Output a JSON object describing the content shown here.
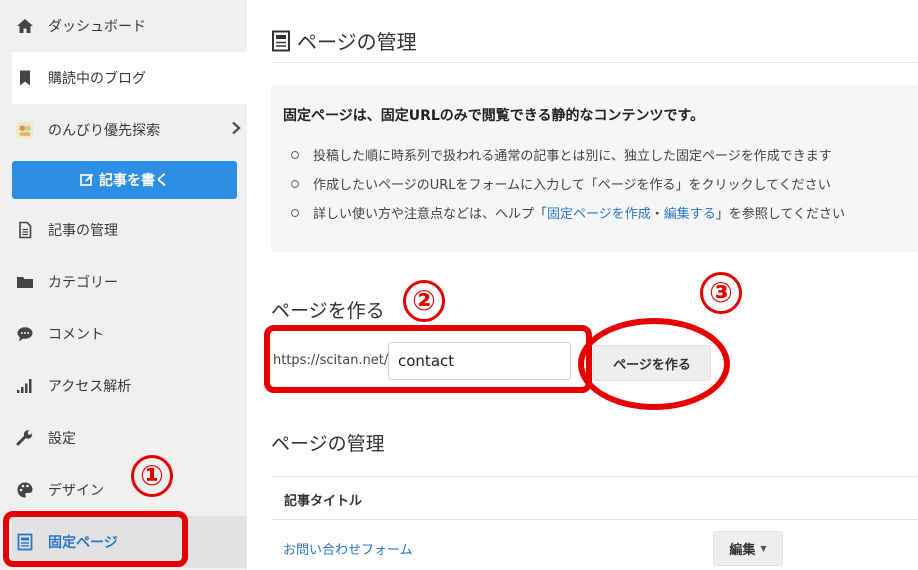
{
  "sidebar": {
    "items": [
      {
        "label": "ダッシュボード",
        "icon": "home-icon"
      },
      {
        "label": "購読中のブログ",
        "icon": "bookmark-icon"
      },
      {
        "label": "のんびり優先探索",
        "icon": "blog-avatar"
      },
      {
        "label": "記事の管理",
        "icon": "document-icon"
      },
      {
        "label": "カテゴリー",
        "icon": "folder-icon"
      },
      {
        "label": "コメント",
        "icon": "comment-icon"
      },
      {
        "label": "アクセス解析",
        "icon": "signal-icon"
      },
      {
        "label": "設定",
        "icon": "wrench-icon"
      },
      {
        "label": "デザイン",
        "icon": "palette-icon"
      },
      {
        "label": "固定ページ",
        "icon": "page-icon"
      }
    ],
    "write_button": "記事を書く",
    "active_color": "#2b76c9",
    "write_button_color": "#2d8fe3"
  },
  "main": {
    "title": "ページの管理",
    "info": {
      "title": "固定ページは、固定URLのみで閲覧できる静的なコンテンツです。",
      "bullet1": "投稿した順に時系列で扱われる通常の記事とは別に、独立した固定ページを作成できます",
      "bullet2": "作成したいページのURLをフォームに入力して「ページを作る」をクリックしてください",
      "bullet3_pre": "詳しい使い方や注意点などは、ヘルプ「",
      "bullet3_link1": "固定ページを作成",
      "bullet3_sep": "・",
      "bullet3_link2": "編集する",
      "bullet3_post": "」を参照してください"
    },
    "create_section": {
      "heading": "ページを作る",
      "url_prefix": "https://scitan.net/",
      "url_value": "contact",
      "button": "ページを作る"
    },
    "manage_section": {
      "heading": "ページの管理",
      "column_header": "記事タイトル",
      "rows": [
        {
          "title": "お問い合わせフォーム",
          "edit": "編集"
        }
      ]
    }
  },
  "annotations": {
    "n1": "①",
    "n2": "②",
    "n3": "③",
    "color": "#e60000"
  }
}
